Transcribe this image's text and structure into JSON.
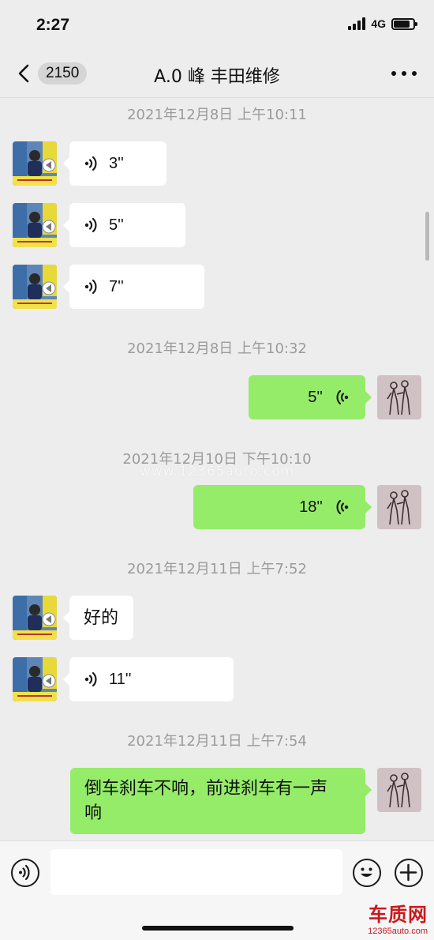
{
  "status_bar": {
    "time": "2:27",
    "network": "4G",
    "battery_level": 0.85
  },
  "nav": {
    "unread_count": "2150",
    "title": "A.0 峰 丰田维修"
  },
  "watermark": "www.12365auto.com",
  "colors": {
    "incoming_bubble": "#ffffff",
    "outgoing_bubble": "#95ec69",
    "background": "#ededed"
  },
  "messages": [
    {
      "type": "timestamp",
      "text": "2021年12月8日 上午10:11"
    },
    {
      "type": "voice",
      "direction": "incoming",
      "duration": "3''"
    },
    {
      "type": "voice",
      "direction": "incoming",
      "duration": "5''"
    },
    {
      "type": "voice",
      "direction": "incoming",
      "duration": "7''"
    },
    {
      "type": "timestamp",
      "text": "2021年12月8日 上午10:32"
    },
    {
      "type": "voice",
      "direction": "outgoing",
      "duration": "5''"
    },
    {
      "type": "timestamp",
      "text": "2021年12月10日 下午10:10"
    },
    {
      "type": "voice",
      "direction": "outgoing",
      "duration": "18''"
    },
    {
      "type": "timestamp",
      "text": "2021年12月11日 上午7:52"
    },
    {
      "type": "text",
      "direction": "incoming",
      "text": "好的"
    },
    {
      "type": "voice",
      "direction": "incoming",
      "duration": "11''"
    },
    {
      "type": "timestamp",
      "text": "2021年12月11日 上午7:54"
    },
    {
      "type": "text",
      "direction": "outgoing",
      "text_lines": [
        "倒车刹车不响，前进刹车有一声",
        "响"
      ]
    }
  ],
  "input_bar": {
    "voice_icon": "voice-mode-icon",
    "emoji_icon": "emoji-icon",
    "plus_icon": "plus-icon"
  },
  "corner_logo": {
    "mark": "车质网",
    "url": "12365auto.com"
  }
}
